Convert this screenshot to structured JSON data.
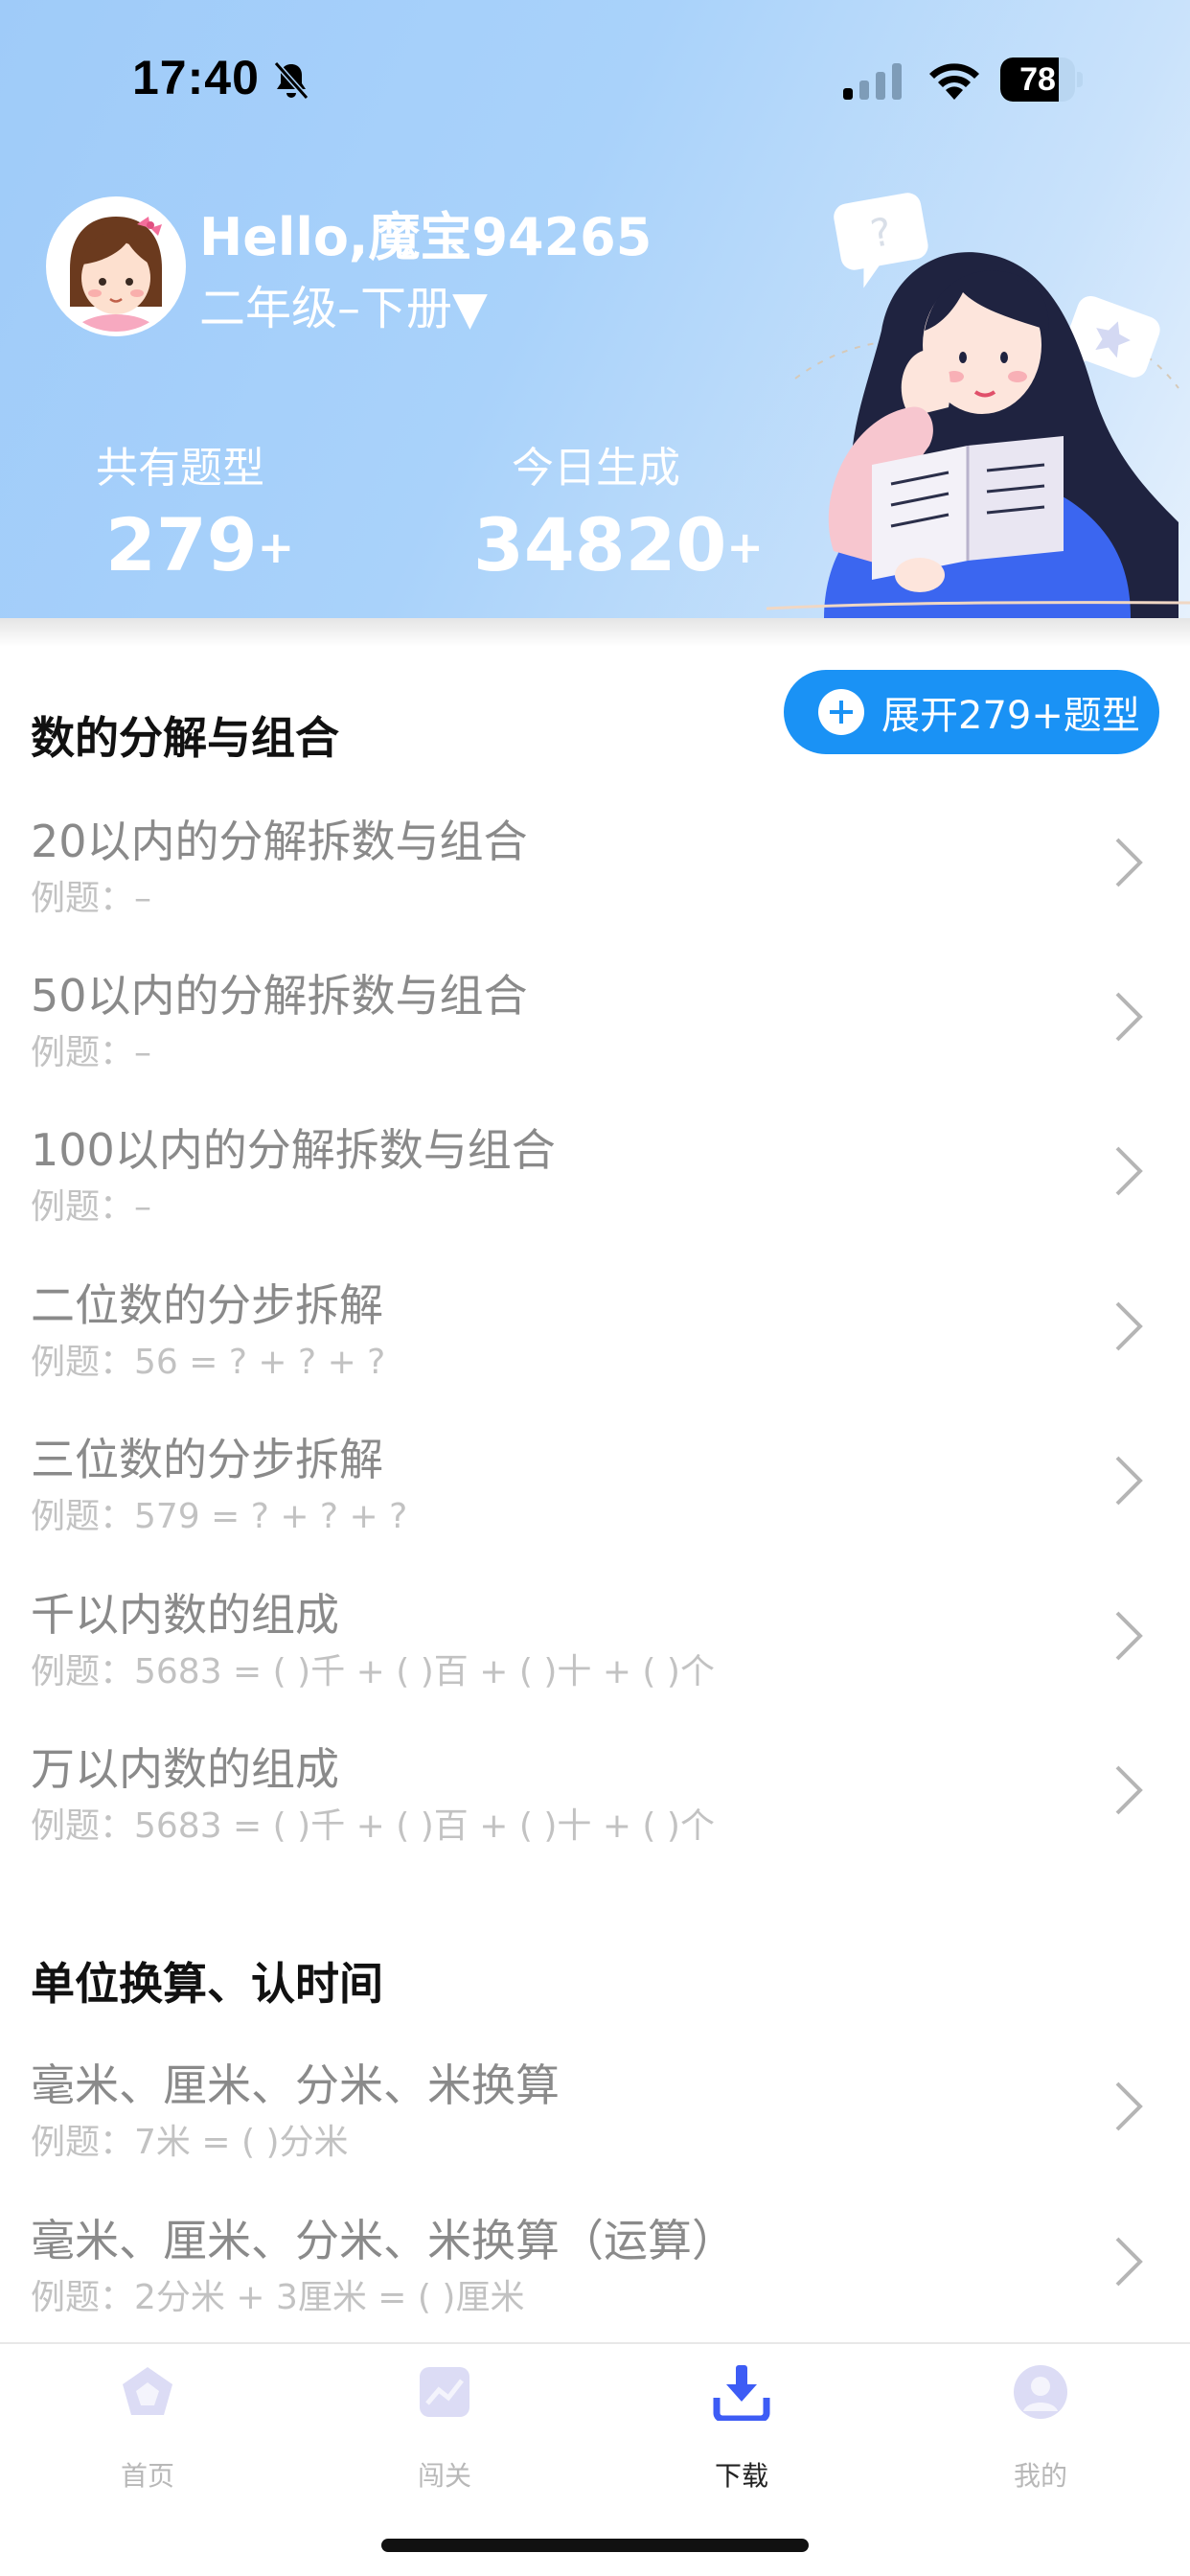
{
  "status_bar": {
    "time": "17:40",
    "battery": "78",
    "battery_level": 0.78,
    "icons": [
      "bell-slash-icon",
      "signal-icon",
      "wifi-icon",
      "battery-icon"
    ]
  },
  "profile": {
    "greeting": "Hello,魔宝94265",
    "grade": "二年级–下册▼"
  },
  "stats": {
    "types_label": "共有题型",
    "types_value": "279",
    "today_label": "今日生成",
    "today_value": "34820",
    "plus": "+"
  },
  "expand_button": {
    "label": "展开279+题型",
    "color": "#1a92f5"
  },
  "sections": [
    {
      "title": "数的分解与组合",
      "items": [
        {
          "title": "20以内的分解拆数与组合",
          "example": "例题：–"
        },
        {
          "title": "50以内的分解拆数与组合",
          "example": "例题：–"
        },
        {
          "title": "100以内的分解拆数与组合",
          "example": "例题：–"
        },
        {
          "title": "二位数的分步拆解",
          "example": "例题：56 = ? + ? + ?"
        },
        {
          "title": "三位数的分步拆解",
          "example": "例题：579 = ? + ? + ?"
        },
        {
          "title": "千以内数的组成",
          "example": "例题：5683 = ( )千 + ( )百 + ( )十 + ( )个"
        },
        {
          "title": "万以内数的组成",
          "example": "例题：5683 = ( )千 + ( )百 + ( )十 + ( )个"
        }
      ]
    },
    {
      "title": "单位换算、认时间",
      "items": [
        {
          "title": "毫米、厘米、分米、米换算",
          "example": "例题：7米 = ( )分米"
        },
        {
          "title": "毫米、厘米、分米、米换算（运算）",
          "example": "例题：2分米 + 3厘米 = ( )厘米"
        }
      ]
    }
  ],
  "tabbar": {
    "tabs": [
      {
        "label": "首页",
        "icon": "home-pentagon-icon",
        "active": false
      },
      {
        "label": "闯关",
        "icon": "chart-icon",
        "active": false
      },
      {
        "label": "下载",
        "icon": "download-icon",
        "active": true
      },
      {
        "label": "我的",
        "icon": "profile-icon",
        "active": false
      }
    ],
    "active_color": "#3d5cf5",
    "inactive_icon_color": "#d8dcf3"
  }
}
